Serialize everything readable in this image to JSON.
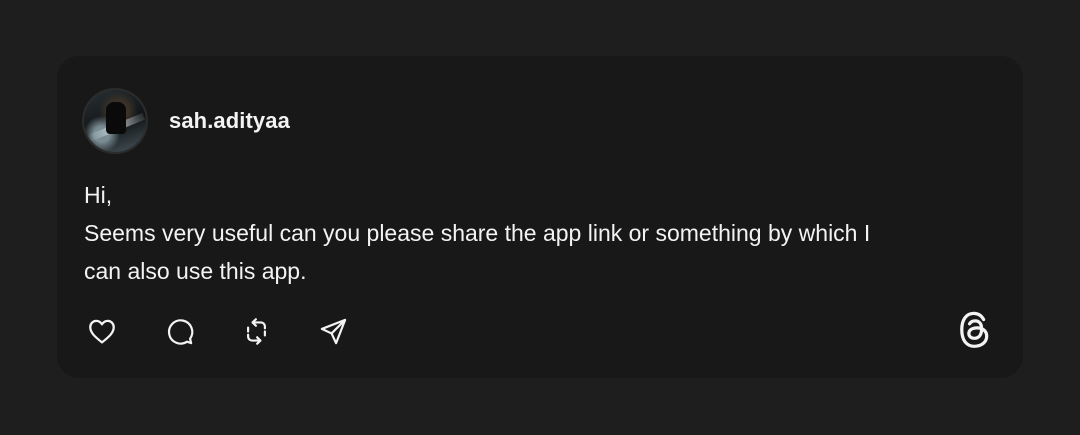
{
  "post": {
    "author": {
      "username": "sah.adityaa",
      "avatar_icon": "user-avatar-photo"
    },
    "text_lines": [
      "Hi,",
      "Seems very useful can you please share the app link or something by which I",
      "can also use this app."
    ],
    "actions": [
      {
        "name": "like",
        "icon": "heart-icon"
      },
      {
        "name": "reply",
        "icon": "comment-icon"
      },
      {
        "name": "repost",
        "icon": "repost-icon"
      },
      {
        "name": "share",
        "icon": "send-icon"
      }
    ],
    "brand_icon": "threads-logo-icon"
  },
  "colors": {
    "page_background": "#1e1e1e",
    "card_background": "#181818",
    "text": "#f3f3f3",
    "icon": "#f3f3f3"
  }
}
